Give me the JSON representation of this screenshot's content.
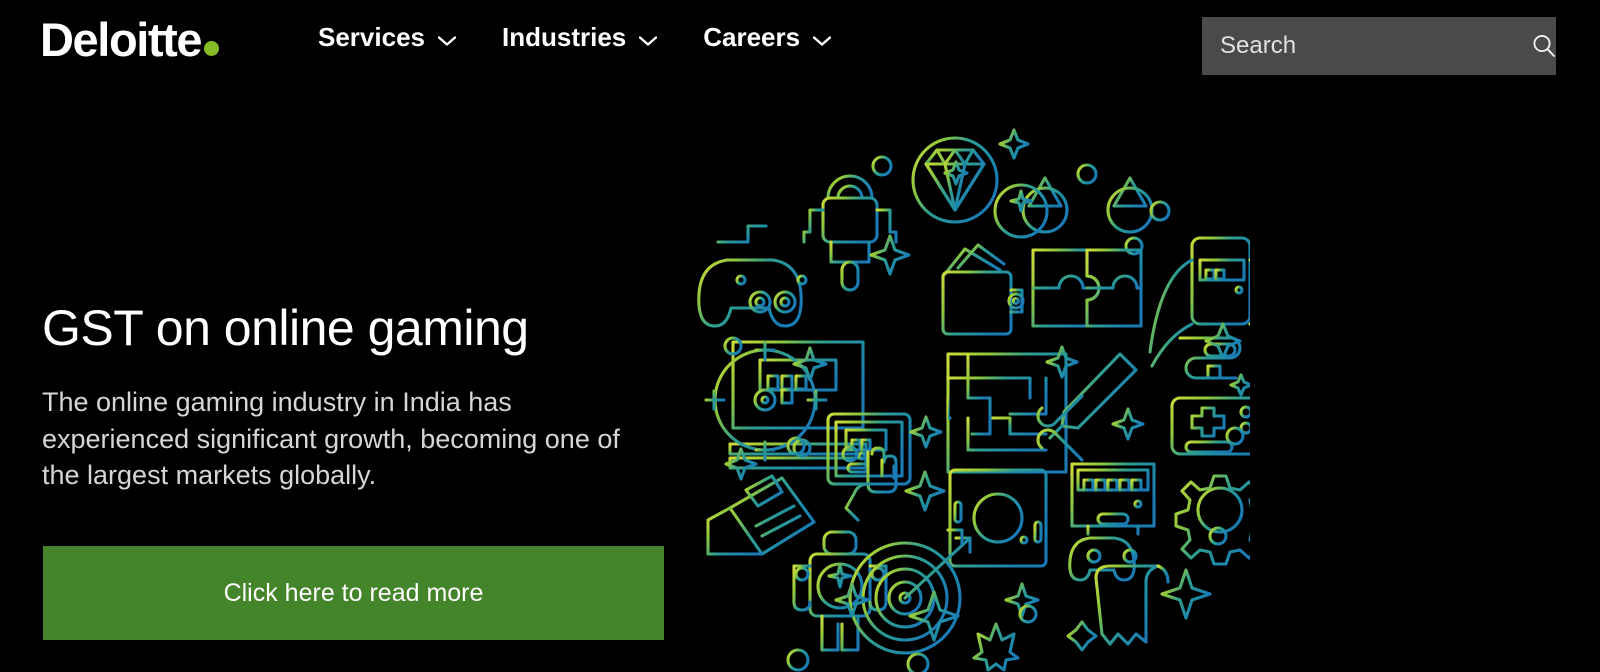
{
  "brand": {
    "name": "Deloitte",
    "dot_color": "#86bc25"
  },
  "nav": {
    "items": [
      {
        "label": "Services",
        "icon": "chevron-down-icon"
      },
      {
        "label": "Industries",
        "icon": "chevron-down-icon"
      },
      {
        "label": "Careers",
        "icon": "chevron-down-icon"
      }
    ]
  },
  "search": {
    "placeholder": "Search",
    "value": "",
    "icon": "search-icon",
    "background": "#4a4a4a"
  },
  "hero": {
    "title": "GST on online gaming",
    "description": "The online gaming industry in India has experienced significant growth, becoming one of the largest markets globally.",
    "cta_label": "Click here to read more",
    "cta_color": "#44842a",
    "background": "#000000",
    "title_color": "#ffffff",
    "description_color": "#d6d6d6"
  },
  "illustration": {
    "name": "online-gaming-icon-circle",
    "description": "Circular composition of line-art gaming icons in a green-to-blue gradient",
    "gradient_start": "#bdd63a",
    "gradient_mid": "#2f9e8f",
    "gradient_end": "#1a7bb5",
    "icons": [
      "game-controller-icon",
      "robot-icon",
      "diamond-in-circle-icon",
      "scales-of-justice-icon",
      "sparkle-icon",
      "wallet-icon",
      "puzzle-icon",
      "phone-gaming-hands-icon",
      "laptop-icon",
      "maze-icon",
      "sword-icon",
      "retro-gamepad-icon",
      "crosshair-target-icon",
      "tablet-hand-icon",
      "credit-cards-icon",
      "astronaut-icon",
      "football-pitch-icon",
      "tv-console-icon",
      "gear-icon",
      "dartboard-arrow-icon",
      "scroll-icon",
      "spaceship-icon",
      "circle-dot-icon"
    ]
  }
}
